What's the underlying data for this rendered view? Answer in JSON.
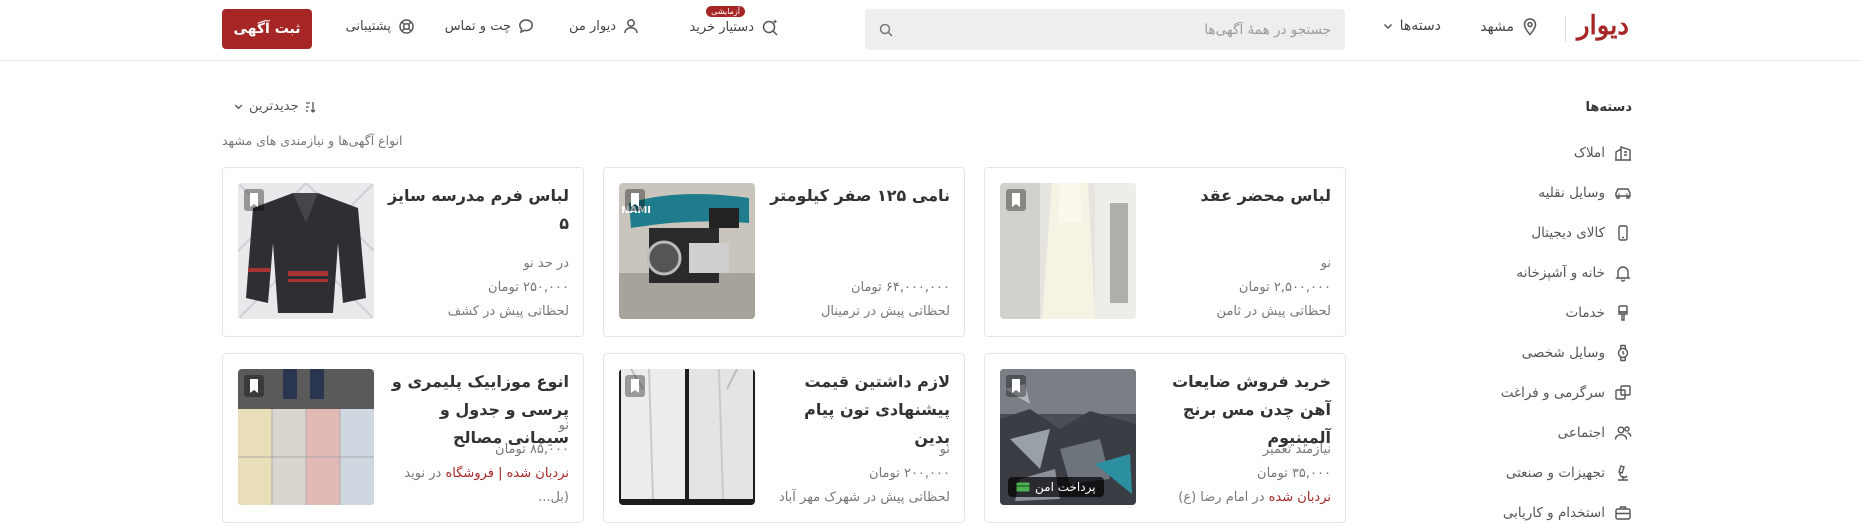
{
  "header": {
    "logo": "دیوار",
    "city": "مشهد",
    "categories_label": "دسته‌ها",
    "search_placeholder": "جستجو در همهٔ آگهی‌ها",
    "nav": {
      "buy_assistant": "دستیار خرید",
      "buy_assistant_badge": "آزمایشی",
      "my_divar": "دیوار من",
      "chat": "چت و تماس",
      "support": "پشتیبانی"
    },
    "post_button": "ثبت آگهی"
  },
  "sidebar": {
    "title": "دسته‌ها",
    "items": [
      {
        "label": "املاک",
        "icon": "building-icon"
      },
      {
        "label": "وسایل نقلیه",
        "icon": "car-icon"
      },
      {
        "label": "کالای دیجیتال",
        "icon": "phone-icon"
      },
      {
        "label": "خانه و آشپزخانه",
        "icon": "bell-icon"
      },
      {
        "label": "خدمات",
        "icon": "brush-icon"
      },
      {
        "label": "وسایل شخصی",
        "icon": "watch-icon"
      },
      {
        "label": "سرگرمی و فراغت",
        "icon": "puzzle-icon"
      },
      {
        "label": "اجتماعی",
        "icon": "people-icon"
      },
      {
        "label": "تجهیزات و صنعتی",
        "icon": "microscope-icon"
      },
      {
        "label": "استخدام و کاریابی",
        "icon": "briefcase-icon"
      }
    ]
  },
  "main": {
    "sort_label": "جدیدترین",
    "subtitle": "انواع آگهی‌ها و نیازمندی های مشهد",
    "cards": [
      {
        "title": "لباس محضر عقد",
        "line1": "نو",
        "line2": "۲,۵۰۰,۰۰۰ تومان",
        "line3": "لحظاتی پیش در ثامن",
        "image": "white-dress"
      },
      {
        "title": "نامی ۱۲۵ صفر کیلومتر",
        "line1": "",
        "line2": "۶۴,۰۰۰,۰۰۰ تومان",
        "line3": "لحظاتی پیش در ترمینال",
        "image": "motorcycle"
      },
      {
        "title": "لباس فرم مدرسه سایز ۵",
        "line1": "در حد نو",
        "line2": "۲۵۰,۰۰۰ تومان",
        "line3": "لحظاتی پیش در کشف",
        "image": "school-uniform"
      },
      {
        "title": "خرید فروش ضایعات آهن چدن مس برنج آلمینیوم",
        "line1": "نیازمند تعمیر",
        "line2": "۳۵,۰۰۰ تومان",
        "line3_red": "نردبان شده",
        "line3_rest": " در امام رضا (ع)",
        "image": "scrap-metal",
        "secure_label": "پرداخت امن"
      },
      {
        "title": "لازم داشتین قیمت پیشنهادی تون پیام بدین",
        "line1": "نو",
        "line2": "۲۰۰,۰۰۰ تومان",
        "line3": "لحظاتی پیش در شهرک مهر آباد",
        "image": "white-shirts"
      },
      {
        "title": "انوع موزاییک پلیمری و پرسی و جدول و سیمانی مصالح",
        "line1": "نو",
        "line2": "۸۵,۰۰۰ تومان",
        "line3_red": "نردبان شده | فروشگاه",
        "line3_rest": " در نوید (بل...",
        "image": "tiles"
      }
    ]
  }
}
